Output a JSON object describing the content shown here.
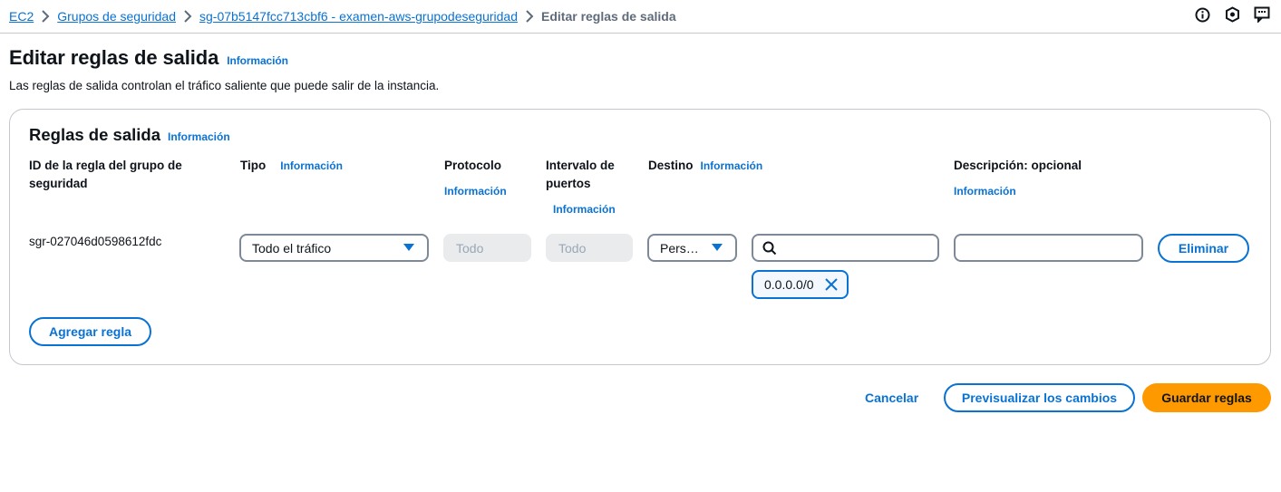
{
  "breadcrumb": {
    "items": [
      "EC2",
      "Grupos de seguridad",
      "sg-07b5147fcc713cbf6 - examen-aws-grupodeseguridad"
    ],
    "current": "Editar reglas de salida"
  },
  "header": {
    "title": "Editar reglas de salida",
    "info": "Información",
    "description": "Las reglas de salida controlan el tráfico saliente que puede salir de la instancia."
  },
  "rules": {
    "title": "Reglas de salida",
    "info": "Información",
    "columns": {
      "rule_id": "ID de la regla del grupo de seguridad",
      "type": "Tipo",
      "type_info": "Información",
      "protocol": "Protocolo",
      "protocol_info": "Información",
      "port_range": "Intervalo de puertos",
      "port_range_info": "Información",
      "destination": "Destino",
      "destination_info": "Información",
      "description": "Descripción: opcional",
      "description_info": "Información"
    },
    "rows": [
      {
        "rule_id": "sgr-027046d0598612fdc",
        "type": "Todo el tráfico",
        "protocol": "Todo",
        "port_range": "Todo",
        "destination_type": "Pers…",
        "destination_search": "",
        "destination_token": "0.0.0.0/0",
        "description": "",
        "delete_label": "Eliminar"
      }
    ],
    "add_rule_label": "Agregar regla"
  },
  "footer": {
    "cancel_label": "Cancelar",
    "preview_label": "Previsualizar los cambios",
    "save_label": "Guardar reglas"
  },
  "colors": {
    "accent": "#0972d3",
    "primary_button": "#ff9900"
  },
  "icons": [
    "chevron-right-icon",
    "info-circle-icon",
    "shield-icon",
    "feedback-icon",
    "search-icon",
    "close-icon",
    "caret-down-icon"
  ]
}
